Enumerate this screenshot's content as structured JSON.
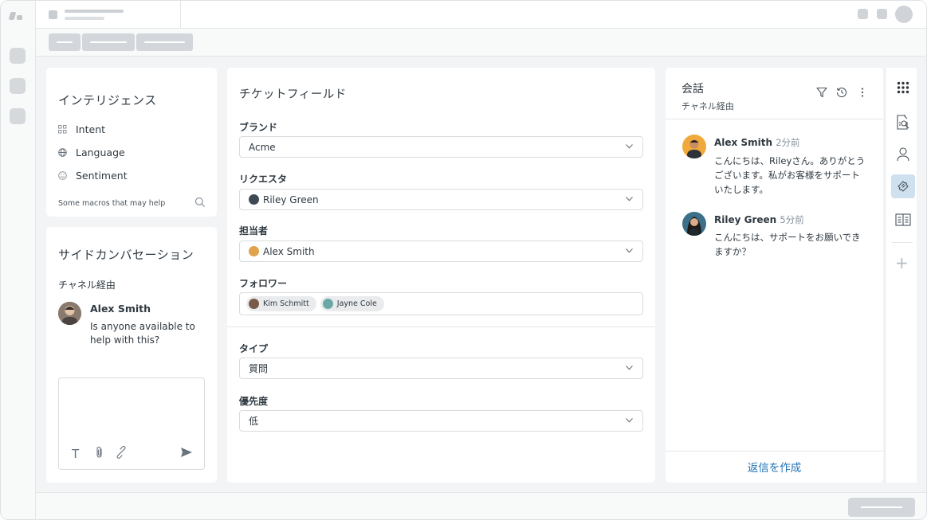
{
  "intelligence": {
    "title": "インテリジェンス",
    "items": [
      {
        "label": "Intent",
        "icon": "grid-icon"
      },
      {
        "label": "Language",
        "icon": "globe-icon"
      },
      {
        "label": "Sentiment",
        "icon": "smiley-icon"
      }
    ],
    "macros_label": "Some macros that may help"
  },
  "side_conversation": {
    "title": "サイドカンバセーション",
    "channel": "チャネル経由",
    "message": {
      "author": "Alex Smith",
      "text": "Is anyone available to help with this?"
    }
  },
  "ticket_fields": {
    "title": "チケットフィールド",
    "brand": {
      "label": "ブランド",
      "value": "Acme"
    },
    "requester": {
      "label": "リクエスタ",
      "value": "Riley Green"
    },
    "assignee": {
      "label": "担当者",
      "value": "Alex Smith"
    },
    "followers": {
      "label": "フォロワー",
      "tags": [
        "Kim Schmitt",
        "Jayne Cole"
      ]
    },
    "type": {
      "label": "タイプ",
      "value": "質問"
    },
    "priority": {
      "label": "優先度",
      "value": "低"
    }
  },
  "conversation": {
    "title": "会話",
    "channel": "チャネル経由",
    "messages": [
      {
        "author": "Alex Smith",
        "time": "2分前",
        "text": "こんにちは、Rileyさん。ありがとうございます。私がお客様をサポートいたします。"
      },
      {
        "author": "Riley Green",
        "time": "5分前",
        "text": "こんにちは、サポートをお願いできますか？"
      }
    ],
    "reply_label": "返信を作成"
  },
  "colors": {
    "accent": "#1f73b7",
    "active_app_bg": "#cfe0ef",
    "background": "#f3f4f5"
  },
  "app_rail_icons": [
    "apps-grid-icon",
    "knowledge-search-icon",
    "user-icon",
    "ticket-icon",
    "knowledge-book-icon",
    "add-icon"
  ]
}
